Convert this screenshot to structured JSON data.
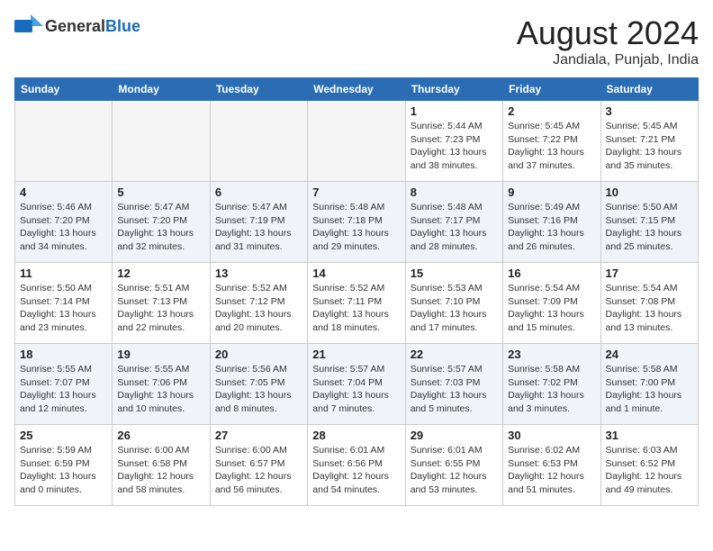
{
  "header": {
    "logo_general": "General",
    "logo_blue": "Blue",
    "month_year": "August 2024",
    "location": "Jandiala, Punjab, India"
  },
  "weekdays": [
    "Sunday",
    "Monday",
    "Tuesday",
    "Wednesday",
    "Thursday",
    "Friday",
    "Saturday"
  ],
  "weeks": [
    [
      {
        "day": "",
        "detail": ""
      },
      {
        "day": "",
        "detail": ""
      },
      {
        "day": "",
        "detail": ""
      },
      {
        "day": "",
        "detail": ""
      },
      {
        "day": "1",
        "detail": "Sunrise: 5:44 AM\nSunset: 7:23 PM\nDaylight: 13 hours\nand 38 minutes."
      },
      {
        "day": "2",
        "detail": "Sunrise: 5:45 AM\nSunset: 7:22 PM\nDaylight: 13 hours\nand 37 minutes."
      },
      {
        "day": "3",
        "detail": "Sunrise: 5:45 AM\nSunset: 7:21 PM\nDaylight: 13 hours\nand 35 minutes."
      }
    ],
    [
      {
        "day": "4",
        "detail": "Sunrise: 5:46 AM\nSunset: 7:20 PM\nDaylight: 13 hours\nand 34 minutes."
      },
      {
        "day": "5",
        "detail": "Sunrise: 5:47 AM\nSunset: 7:20 PM\nDaylight: 13 hours\nand 32 minutes."
      },
      {
        "day": "6",
        "detail": "Sunrise: 5:47 AM\nSunset: 7:19 PM\nDaylight: 13 hours\nand 31 minutes."
      },
      {
        "day": "7",
        "detail": "Sunrise: 5:48 AM\nSunset: 7:18 PM\nDaylight: 13 hours\nand 29 minutes."
      },
      {
        "day": "8",
        "detail": "Sunrise: 5:48 AM\nSunset: 7:17 PM\nDaylight: 13 hours\nand 28 minutes."
      },
      {
        "day": "9",
        "detail": "Sunrise: 5:49 AM\nSunset: 7:16 PM\nDaylight: 13 hours\nand 26 minutes."
      },
      {
        "day": "10",
        "detail": "Sunrise: 5:50 AM\nSunset: 7:15 PM\nDaylight: 13 hours\nand 25 minutes."
      }
    ],
    [
      {
        "day": "11",
        "detail": "Sunrise: 5:50 AM\nSunset: 7:14 PM\nDaylight: 13 hours\nand 23 minutes."
      },
      {
        "day": "12",
        "detail": "Sunrise: 5:51 AM\nSunset: 7:13 PM\nDaylight: 13 hours\nand 22 minutes."
      },
      {
        "day": "13",
        "detail": "Sunrise: 5:52 AM\nSunset: 7:12 PM\nDaylight: 13 hours\nand 20 minutes."
      },
      {
        "day": "14",
        "detail": "Sunrise: 5:52 AM\nSunset: 7:11 PM\nDaylight: 13 hours\nand 18 minutes."
      },
      {
        "day": "15",
        "detail": "Sunrise: 5:53 AM\nSunset: 7:10 PM\nDaylight: 13 hours\nand 17 minutes."
      },
      {
        "day": "16",
        "detail": "Sunrise: 5:54 AM\nSunset: 7:09 PM\nDaylight: 13 hours\nand 15 minutes."
      },
      {
        "day": "17",
        "detail": "Sunrise: 5:54 AM\nSunset: 7:08 PM\nDaylight: 13 hours\nand 13 minutes."
      }
    ],
    [
      {
        "day": "18",
        "detail": "Sunrise: 5:55 AM\nSunset: 7:07 PM\nDaylight: 13 hours\nand 12 minutes."
      },
      {
        "day": "19",
        "detail": "Sunrise: 5:55 AM\nSunset: 7:06 PM\nDaylight: 13 hours\nand 10 minutes."
      },
      {
        "day": "20",
        "detail": "Sunrise: 5:56 AM\nSunset: 7:05 PM\nDaylight: 13 hours\nand 8 minutes."
      },
      {
        "day": "21",
        "detail": "Sunrise: 5:57 AM\nSunset: 7:04 PM\nDaylight: 13 hours\nand 7 minutes."
      },
      {
        "day": "22",
        "detail": "Sunrise: 5:57 AM\nSunset: 7:03 PM\nDaylight: 13 hours\nand 5 minutes."
      },
      {
        "day": "23",
        "detail": "Sunrise: 5:58 AM\nSunset: 7:02 PM\nDaylight: 13 hours\nand 3 minutes."
      },
      {
        "day": "24",
        "detail": "Sunrise: 5:58 AM\nSunset: 7:00 PM\nDaylight: 13 hours\nand 1 minute."
      }
    ],
    [
      {
        "day": "25",
        "detail": "Sunrise: 5:59 AM\nSunset: 6:59 PM\nDaylight: 13 hours\nand 0 minutes."
      },
      {
        "day": "26",
        "detail": "Sunrise: 6:00 AM\nSunset: 6:58 PM\nDaylight: 12 hours\nand 58 minutes."
      },
      {
        "day": "27",
        "detail": "Sunrise: 6:00 AM\nSunset: 6:57 PM\nDaylight: 12 hours\nand 56 minutes."
      },
      {
        "day": "28",
        "detail": "Sunrise: 6:01 AM\nSunset: 6:56 PM\nDaylight: 12 hours\nand 54 minutes."
      },
      {
        "day": "29",
        "detail": "Sunrise: 6:01 AM\nSunset: 6:55 PM\nDaylight: 12 hours\nand 53 minutes."
      },
      {
        "day": "30",
        "detail": "Sunrise: 6:02 AM\nSunset: 6:53 PM\nDaylight: 12 hours\nand 51 minutes."
      },
      {
        "day": "31",
        "detail": "Sunrise: 6:03 AM\nSunset: 6:52 PM\nDaylight: 12 hours\nand 49 minutes."
      }
    ]
  ]
}
